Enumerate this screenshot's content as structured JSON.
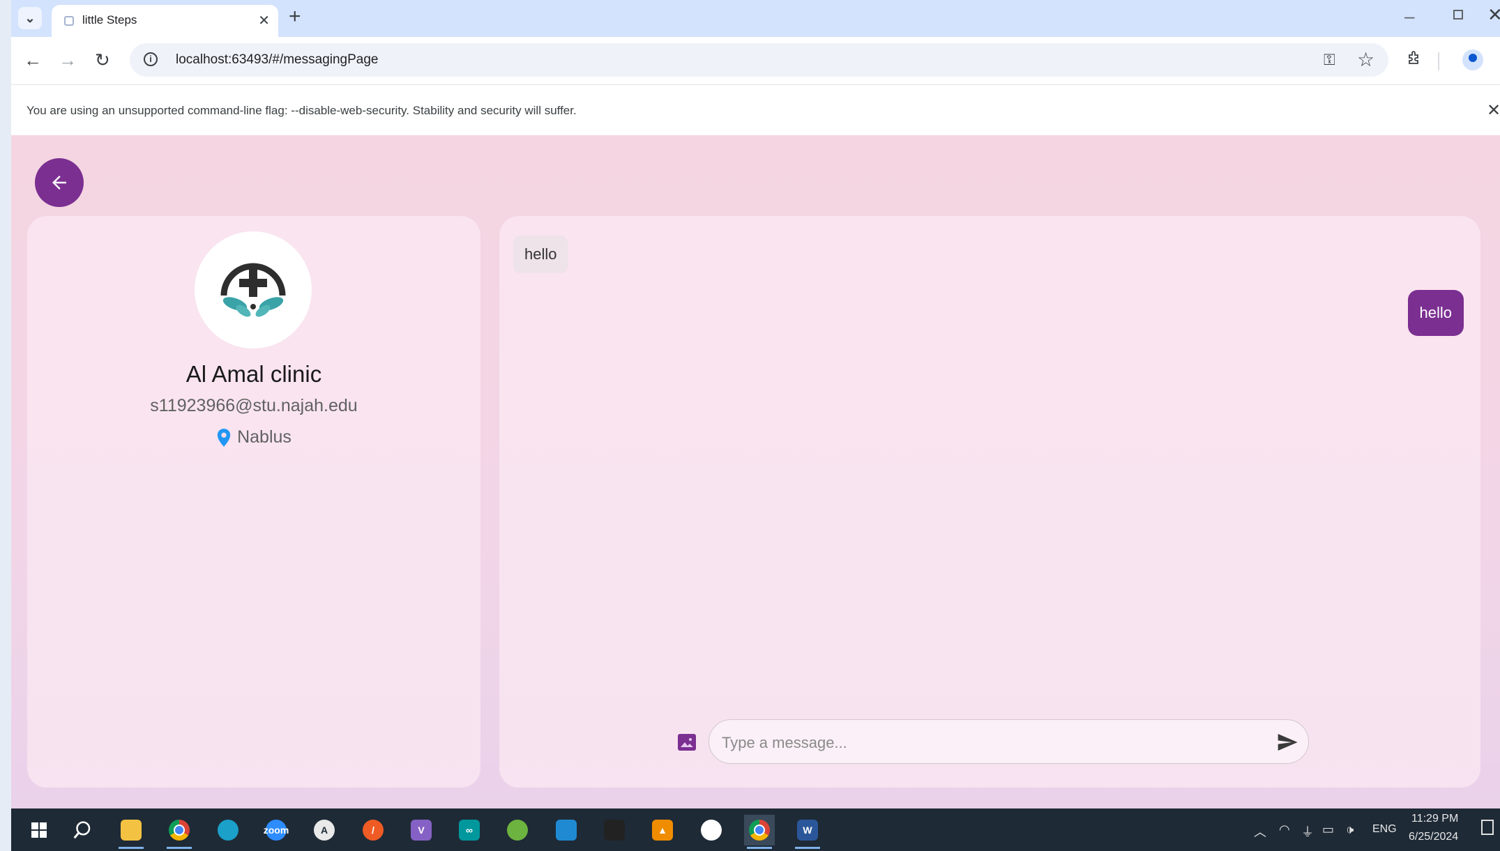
{
  "browser": {
    "tab": {
      "title": "little Steps",
      "close_glyph": "✕"
    },
    "new_tab_glyph": "+",
    "url": "localhost:63493/#/messagingPage",
    "infobar": {
      "message": "You are using an unsupported command-line flag: --disable-web-security. Stability and security will suffer.",
      "close_glyph": "✕"
    },
    "window": {
      "minimize_glyph": "–",
      "close_glyph": "✕"
    },
    "nav": {
      "back_glyph": "←",
      "forward_glyph": "→",
      "reload_glyph": "↻",
      "star_glyph": "☆",
      "key_glyph": "⚿",
      "menu_glyph": "⋮",
      "tab_search_glyph": "⌄"
    }
  },
  "profile": {
    "name": "Al Amal clinic",
    "email": "s11923966@stu.najah.edu",
    "location": "Nablus"
  },
  "chat": {
    "messages": [
      {
        "direction": "incoming",
        "text": "hello"
      },
      {
        "direction": "outgoing",
        "text": "hello"
      }
    ],
    "input": {
      "placeholder": "Type a message...",
      "value": ""
    }
  },
  "taskbar": {
    "apps": [
      {
        "name": "file-explorer-icon",
        "color": "#f4c242",
        "glyph": ""
      },
      {
        "name": "chrome-icon",
        "color": "#db4437",
        "glyph": ""
      },
      {
        "name": "edge-icon",
        "color": "#1aa0c9",
        "glyph": ""
      },
      {
        "name": "zoom-icon",
        "color": "#2d8cff",
        "glyph": "zoom"
      },
      {
        "name": "app-store-icon",
        "color": "#e9e9e9",
        "glyph": "A"
      },
      {
        "name": "postman-icon",
        "color": "#ef5b25",
        "glyph": "/"
      },
      {
        "name": "visual-studio-icon",
        "color": "#8661c5",
        "glyph": "V"
      },
      {
        "name": "arduino-icon",
        "color": "#00979d",
        "glyph": "∞"
      },
      {
        "name": "spring-icon",
        "color": "#6db33f",
        "glyph": ""
      },
      {
        "name": "vscode-icon",
        "color": "#1f8ad2",
        "glyph": ""
      },
      {
        "name": "figma-icon",
        "color": "#222222",
        "glyph": ""
      },
      {
        "name": "vlc-icon",
        "color": "#f08c00",
        "glyph": "▲"
      },
      {
        "name": "mongodb-compass-icon",
        "color": "#ffffff",
        "glyph": ""
      },
      {
        "name": "chrome-active-icon",
        "color": "#db4437",
        "glyph": ""
      },
      {
        "name": "word-icon",
        "color": "#2b579a",
        "glyph": "W"
      }
    ],
    "language": "ENG",
    "time": "11:29 PM",
    "date": "6/25/2024"
  },
  "colors": {
    "accent": "#7b2f91",
    "location_pin": "#2196f3",
    "incoming_bubble": "#eee3e9",
    "chrome_tabstrip": "#d3e3fd"
  }
}
